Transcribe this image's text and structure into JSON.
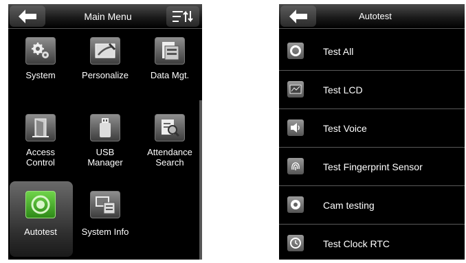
{
  "main_menu": {
    "title": "Main Menu",
    "back_icon": "back-arrow-icon",
    "sort_icon": "sort-menu-icon",
    "items": [
      {
        "label": "System",
        "icon": "gear-icon"
      },
      {
        "label": "Personalize",
        "icon": "paint-brush-icon"
      },
      {
        "label": "Data Mgt.",
        "icon": "database-icon"
      },
      {
        "label": "Access\nControl",
        "icon": "door-icon"
      },
      {
        "label": "USB\nManager",
        "icon": "usb-drive-icon"
      },
      {
        "label": "Attendance\nSearch",
        "icon": "search-records-icon"
      },
      {
        "label": "Autotest",
        "icon": "autotest-icon",
        "selected": true
      },
      {
        "label": "System Info",
        "icon": "computer-icon"
      }
    ]
  },
  "autotest": {
    "title": "Autotest",
    "back_icon": "back-arrow-icon",
    "items": [
      {
        "label": "Test All",
        "icon": "circle-icon"
      },
      {
        "label": "Test LCD",
        "icon": "lcd-icon"
      },
      {
        "label": "Test Voice",
        "icon": "speaker-icon"
      },
      {
        "label": "Test Fingerprint Sensor",
        "icon": "fingerprint-icon"
      },
      {
        "label": "Cam testing",
        "icon": "camera-icon"
      },
      {
        "label": "Test Clock RTC",
        "icon": "clock-icon"
      }
    ]
  },
  "colors": {
    "screen_bg": "#000000",
    "selected_icon_green": "#4caf28",
    "divider": "#5a5a5a"
  }
}
